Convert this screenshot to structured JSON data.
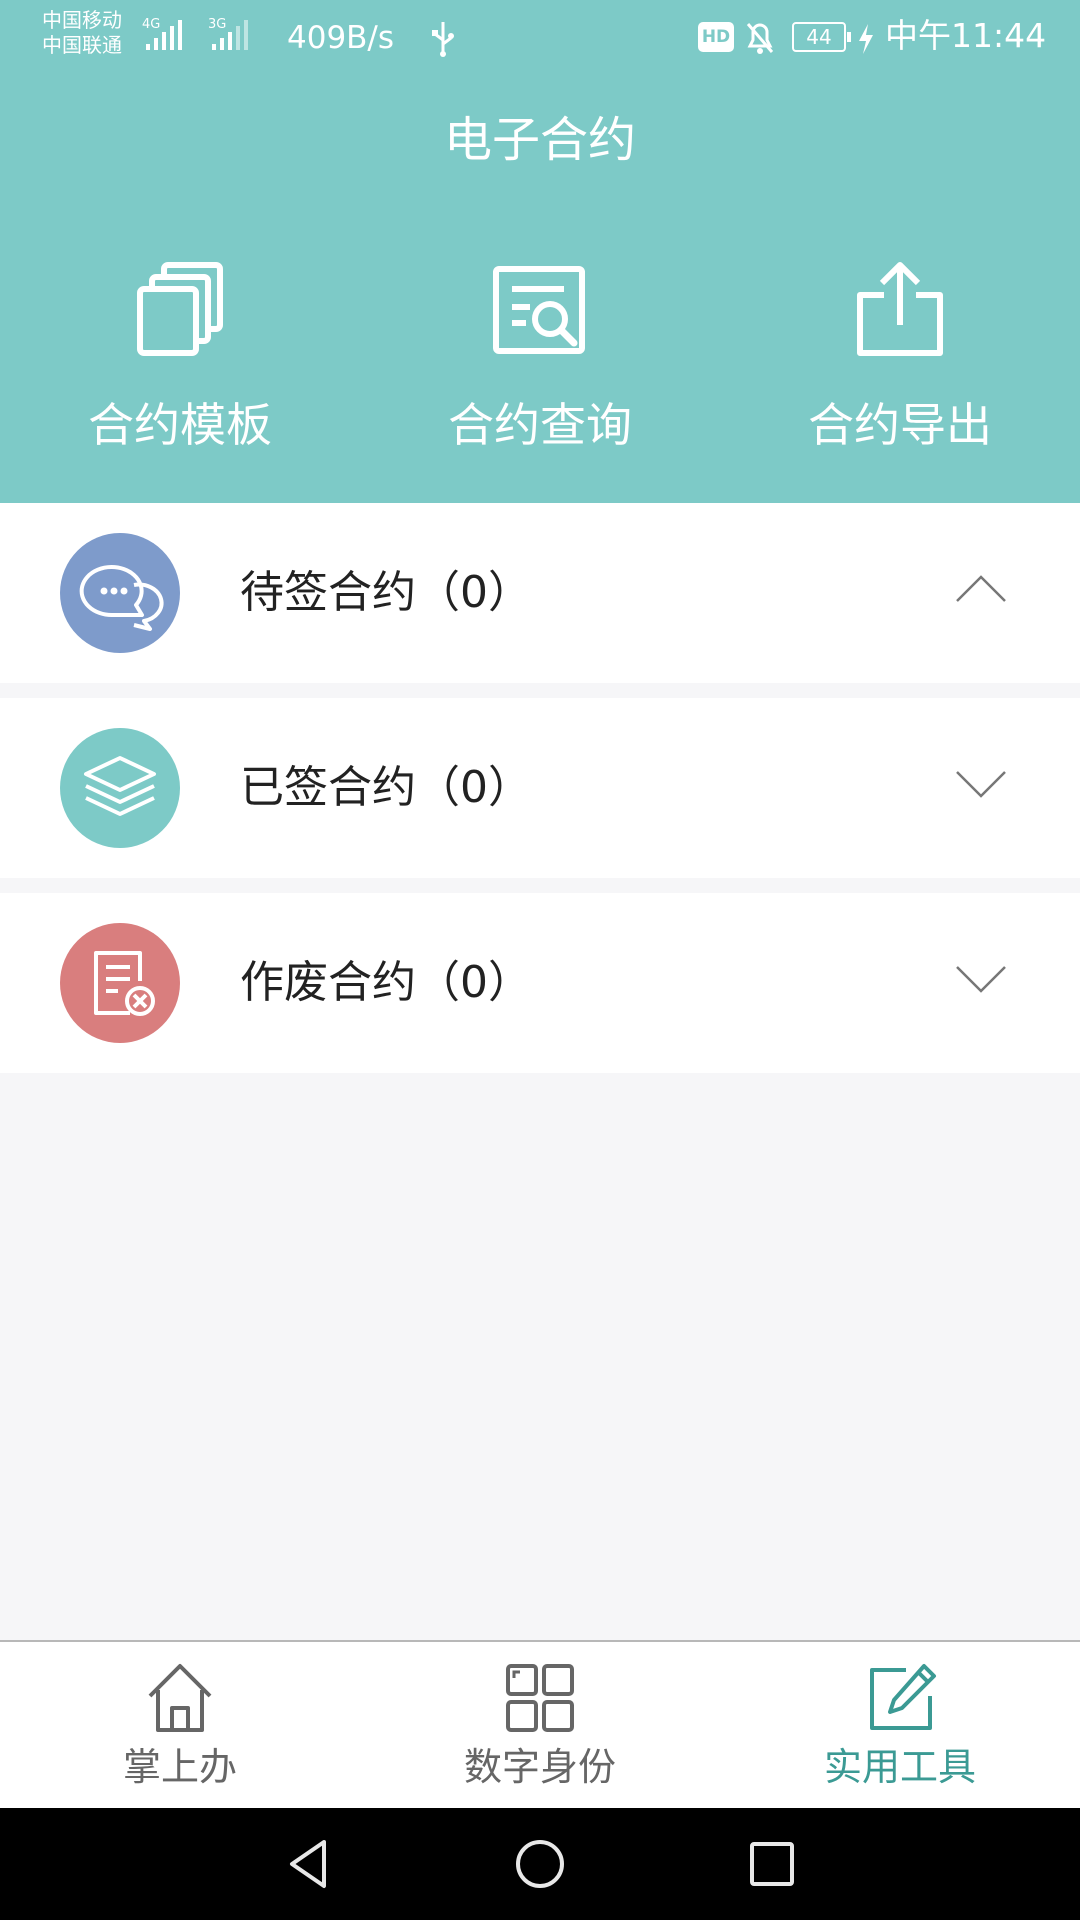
{
  "status_bar": {
    "carrier_1": "中国移动",
    "carrier_2": "中国联通",
    "signal_1_label": "4G",
    "signal_2_label": "3G",
    "net_speed": "409B/s",
    "hd_badge": "HD",
    "battery": "44",
    "time": "中午11:44"
  },
  "header": {
    "title": "电子合约",
    "actions": [
      {
        "label": "合约模板",
        "icon": "stacked-pages-icon"
      },
      {
        "label": "合约查询",
        "icon": "document-search-icon"
      },
      {
        "label": "合约导出",
        "icon": "share-export-icon"
      }
    ]
  },
  "sections": [
    {
      "label": "待签合约（0）",
      "icon": "chat-bubbles-icon",
      "color": "#7e9bcb",
      "expanded": true
    },
    {
      "label": "已签合约（0）",
      "icon": "layers-icon",
      "color": "#7dcac7",
      "expanded": false
    },
    {
      "label": "作废合约（0）",
      "icon": "document-cancel-icon",
      "color": "#d97e7e",
      "expanded": false
    }
  ],
  "bottom_nav": {
    "tabs": [
      {
        "label": "掌上办",
        "icon": "home-icon",
        "active": false
      },
      {
        "label": "数字身份",
        "icon": "grid-icon",
        "active": false
      },
      {
        "label": "实用工具",
        "icon": "edit-icon",
        "active": true
      }
    ]
  },
  "colors": {
    "header_bg": "#7dcac7",
    "accent": "#3b9a94",
    "page_bg": "#f6f6f8"
  }
}
